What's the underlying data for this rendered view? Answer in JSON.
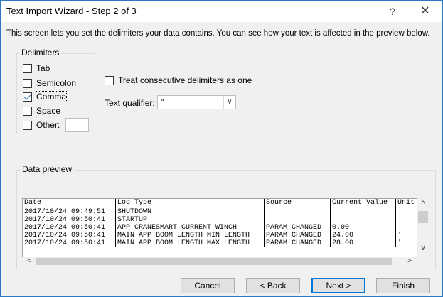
{
  "window": {
    "title": "Text Import Wizard - Step 2 of 3",
    "help_label": "?",
    "close_label": "✕"
  },
  "intro_text": "This screen lets you set the delimiters your data contains.  You can see how your text is affected in the preview below.",
  "delimiters": {
    "group_label": "Delimiters",
    "tab": {
      "label": "Tab",
      "checked": false
    },
    "semicolon": {
      "label": "Semicolon",
      "checked": false
    },
    "comma": {
      "label": "Comma",
      "checked": true
    },
    "space": {
      "label": "Space",
      "checked": false
    },
    "other": {
      "label": "Other:",
      "checked": false,
      "value": ""
    }
  },
  "consecutive": {
    "label": "Treat consecutive delimiters as one",
    "checked": false
  },
  "text_qualifier": {
    "label": "Text qualifier:",
    "value": "\""
  },
  "preview": {
    "group_label": "Data preview",
    "header": [
      "Date",
      "Log Type",
      "Source",
      "Current Value",
      "Unit"
    ],
    "rows": [
      [
        "2017/10/24 09:49:51",
        "SHUTDOWN",
        "",
        "",
        ""
      ],
      [
        "2017/10/24 09:50:41",
        "STARTUP",
        "",
        "",
        ""
      ],
      [
        "2017/10/24 09:50:41",
        "APP CRANESMART CURRENT WINCH",
        "PARAM CHANGED",
        "0.00",
        ""
      ],
      [
        "2017/10/24 09:50:41",
        "MAIN APP BOOM LENGTH MIN LENGTH",
        "PARAM CHANGED",
        "24.00",
        "'"
      ],
      [
        "2017/10/24 09:50:41",
        "MAIN APP BOOM LENGTH MAX LENGTH",
        "PARAM CHANGED",
        "28.00",
        "'"
      ]
    ]
  },
  "buttons": {
    "cancel": "Cancel",
    "back": "< Back",
    "next": "Next >",
    "finish": "Finish"
  },
  "icons": {
    "dropdown": "chevron-down-icon",
    "scroll_up": "caret-up-icon",
    "scroll_down": "caret-down-icon",
    "scroll_left": "caret-left-icon",
    "scroll_right": "caret-right-icon"
  },
  "colors": {
    "window_border": "#2b78c5",
    "default_button_border": "#0078d7",
    "check_mark": "#2d6db5"
  }
}
